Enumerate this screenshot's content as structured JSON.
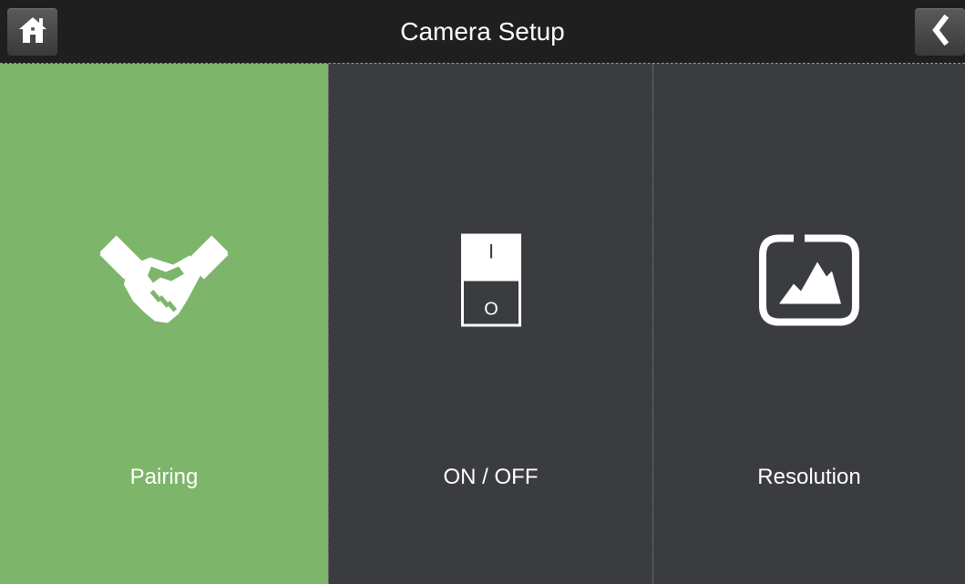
{
  "header": {
    "title": "Camera Setup",
    "home_icon": "home-icon",
    "back_icon": "chevron-left-icon"
  },
  "tiles": [
    {
      "label": "Pairing",
      "icon": "handshake-icon",
      "selected": true
    },
    {
      "label": "ON / OFF",
      "icon": "power-switch-icon",
      "selected": false
    },
    {
      "label": "Resolution",
      "icon": "image-landscape-icon",
      "selected": false
    }
  ],
  "switch_icon": {
    "on_mark": "I",
    "off_mark": "O"
  },
  "colors": {
    "selected_tile": "#7db56a",
    "tile": "#3a3c3f",
    "topbar": "#1f1f1f",
    "text": "#ffffff"
  }
}
